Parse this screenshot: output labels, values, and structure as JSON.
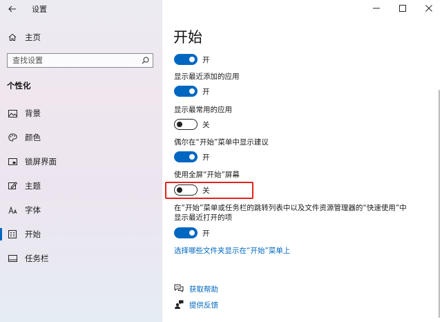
{
  "window": {
    "title": "设置",
    "controls": [
      "minimize-icon",
      "maximize-icon",
      "close-icon"
    ]
  },
  "sidebar": {
    "home_label": "主页",
    "search_placeholder": "查找设置",
    "section_header": "个性化",
    "items": [
      {
        "label": "背景",
        "icon": "picture-icon",
        "active": false
      },
      {
        "label": "颜色",
        "icon": "palette-icon",
        "active": false
      },
      {
        "label": "锁屏界面",
        "icon": "lock-screen-icon",
        "active": false
      },
      {
        "label": "主题",
        "icon": "theme-brush-icon",
        "active": false
      },
      {
        "label": "字体",
        "icon": "font-icon",
        "active": false
      },
      {
        "label": "开始",
        "icon": "start-menu-icon",
        "active": true
      },
      {
        "label": "任务栏",
        "icon": "taskbar-icon",
        "active": false
      }
    ]
  },
  "main": {
    "title": "开始",
    "settings": [
      {
        "label": "",
        "state": "开",
        "on": true
      },
      {
        "label": "显示最近添加的应用",
        "state": "开",
        "on": true
      },
      {
        "label": "显示最常用的应用",
        "state": "关",
        "on": false
      },
      {
        "label": "偶尔在“开始”菜单中显示建议",
        "state": "开",
        "on": true
      },
      {
        "label": "使用全屏“开始”屏幕",
        "state": "关",
        "on": false,
        "highlighted": true
      },
      {
        "label": "在“开始”菜单或任务栏的跳转列表中以及文件资源管理器的“快速使用”中显示最近打开的项",
        "state": "开",
        "on": true
      }
    ],
    "folders_link": "选择哪些文件夹显示在“开始”菜单上",
    "help_link": "获取帮助",
    "feedback_link": "提供反馈"
  },
  "colors": {
    "accent": "#0067c0",
    "highlight_border": "#e2231a"
  }
}
